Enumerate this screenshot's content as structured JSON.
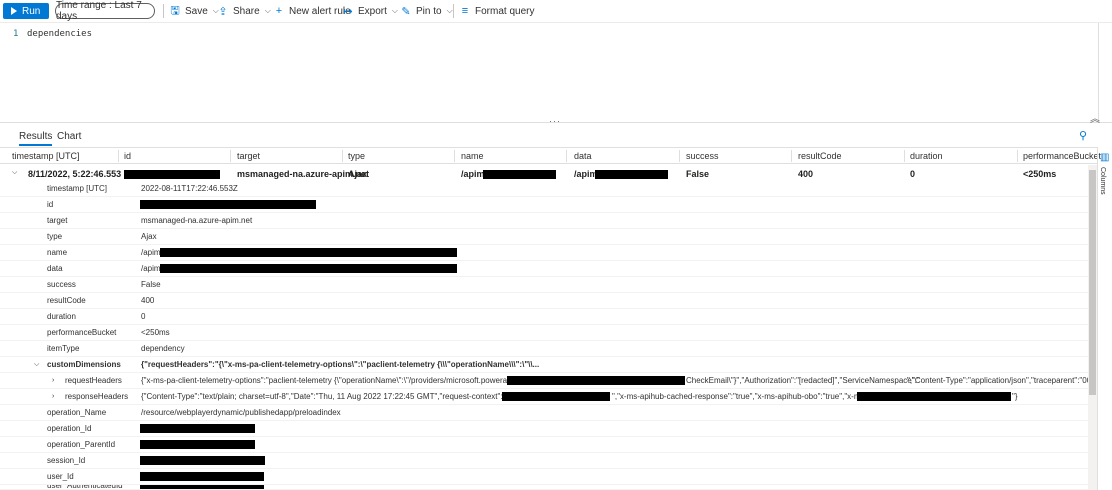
{
  "toolbar": {
    "run_label": "Run",
    "time_range": "Time range : Last 7 days",
    "save_label": "Save",
    "share_label": "Share",
    "new_alert_label": "New alert rule",
    "export_label": "Export",
    "pin_label": "Pin to",
    "format_label": "Format query"
  },
  "editor": {
    "line_number": "1",
    "query": "dependencies"
  },
  "results": {
    "tabs": [
      "Results",
      "Chart"
    ],
    "columns": [
      "timestamp [UTC]",
      "id",
      "target",
      "type",
      "name",
      "data",
      "success",
      "resultCode",
      "duration",
      "performanceBucket"
    ],
    "row": {
      "timestamp": "8/11/2022, 5:22:46.553 PM",
      "target": "msmanaged-na.azure-apim.net",
      "type": "Ajax",
      "name": "/apim/",
      "data": "/apim/",
      "success": "False",
      "resultCode": "400",
      "duration": "0",
      "performanceBucket": "<250ms"
    },
    "details": [
      {
        "key": "timestamp [UTC]",
        "value": "2022-08-11T17:22:46.553Z"
      },
      {
        "key": "id",
        "value": ""
      },
      {
        "key": "target",
        "value": "msmanaged-na.azure-apim.net"
      },
      {
        "key": "type",
        "value": "Ajax"
      },
      {
        "key": "name",
        "value": "/apim/"
      },
      {
        "key": "data",
        "value": "/apim/"
      },
      {
        "key": "success",
        "value": "False"
      },
      {
        "key": "resultCode",
        "value": "400"
      },
      {
        "key": "duration",
        "value": "0"
      },
      {
        "key": "performanceBucket",
        "value": "<250ms"
      },
      {
        "key": "itemType",
        "value": "dependency"
      },
      {
        "key": "customDimensions",
        "value": "{\"requestHeaders\":\"{\\\"x-ms-pa-client-telemetry-options\\\":\\\"paclient-telemetry {\\\\\\\"operationName\\\\\\\":\\\"\\\\..."
      },
      {
        "key": "requestHeaders",
        "value": "{\"x-ms-pa-client-telemetry-options\":\"paclient-telemetry {\\\"operationName\\\":\\\"/providers/microsoft.powerapps/apis/shared_"
      },
      {
        "key": "responseHeaders",
        "value": "{\"Content-Type\":\"text/plain; charset=utf-8\",\"Date\":\"Thu, 11 Aug 2022 17:22:45 GMT\",\"request-context\":\"appId=cid-v"
      },
      {
        "key": "operation_Name",
        "value": "/resource/webplayerdynamic/publishedapp/preloadindex"
      },
      {
        "key": "operation_Id",
        "value": ""
      },
      {
        "key": "operation_ParentId",
        "value": ""
      },
      {
        "key": "session_Id",
        "value": ""
      },
      {
        "key": "user_Id",
        "value": ""
      },
      {
        "key": "user_AuthenticatedId",
        "value": ""
      }
    ],
    "request_tail": "CheckEmail\\\"}\",\"Authorization\":\"[redacted]\",\"ServiceNamespace\":\"",
    "request_tail2": "\",\"Content-Type\":\"application/json\",\"traceparent\":\"00-1",
    "response_tail": "\",\"x-ms-apihub-cached-response\":\"true\",\"x-ms-apihub-obo\":\"true\",\"x-ms-client-request-id\":\"",
    "response_end": "\"}"
  },
  "side_panel": {
    "label": "Columns"
  },
  "colors": {
    "accent": "#0078d4",
    "redaction": "#000000"
  }
}
